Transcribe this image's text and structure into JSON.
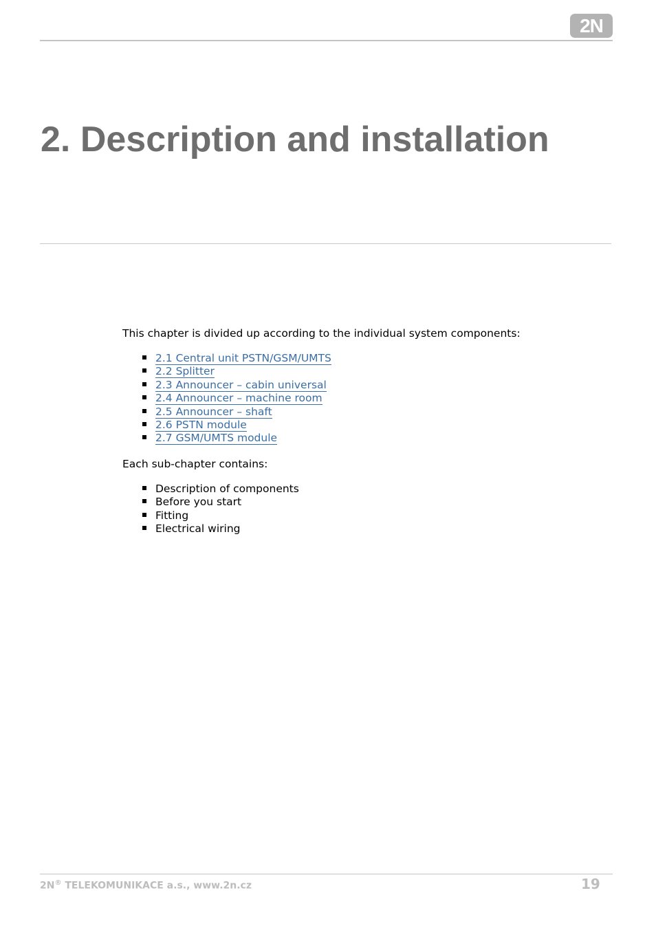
{
  "header": {
    "logo_text": "2N"
  },
  "chapter": {
    "title": "2. Description and installation"
  },
  "intro": {
    "text": "This chapter is divided up according to the individual system components:"
  },
  "links": [
    {
      "label": "2.1 Central unit PSTN/GSM/UMTS"
    },
    {
      "label": "2.2 Splitter"
    },
    {
      "label": "2.3 Announcer – cabin universal"
    },
    {
      "label": "2.4 Announcer – machine room"
    },
    {
      "label": "2.5 Announcer – shaft"
    },
    {
      "label": "2.6 PSTN module"
    },
    {
      "label": "2.7 GSM/UMTS module"
    }
  ],
  "subchapter": {
    "text": "Each sub-chapter contains:",
    "items": [
      "Description of components",
      "Before you start",
      "Fitting",
      "Electrical wiring"
    ]
  },
  "footer": {
    "brand": "2N",
    "registered": "®",
    "company": " TELEKOMUNIKACE a.s., www.2n.cz",
    "page_number": "19"
  },
  "colors": {
    "link": "#3a6ea5",
    "title": "#6e6e6e",
    "footer": "#bdbdbd"
  }
}
